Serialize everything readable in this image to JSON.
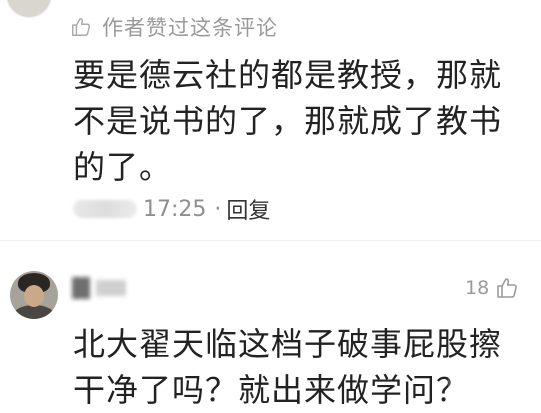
{
  "comment1": {
    "liked_notice": "作者赞过这条评论",
    "body_lines": [
      "要是德云社的都是教授，那就",
      "不是说书的了，那就成了教书",
      "的了。"
    ],
    "time": "17:25",
    "separator": "·",
    "reply_label": "回复"
  },
  "comment2": {
    "like_count": "18",
    "body_lines": [
      "北大翟天临这档子破事屁股擦",
      "干净了吗？就出来做学问？"
    ]
  },
  "icons": {
    "liked_notice_icon": "thumbs-up-outline-icon",
    "like_button_icon": "thumbs-up-outline-icon"
  },
  "colors": {
    "text": "#222222",
    "muted": "#9a9a9a",
    "divider": "#eeeeee"
  }
}
